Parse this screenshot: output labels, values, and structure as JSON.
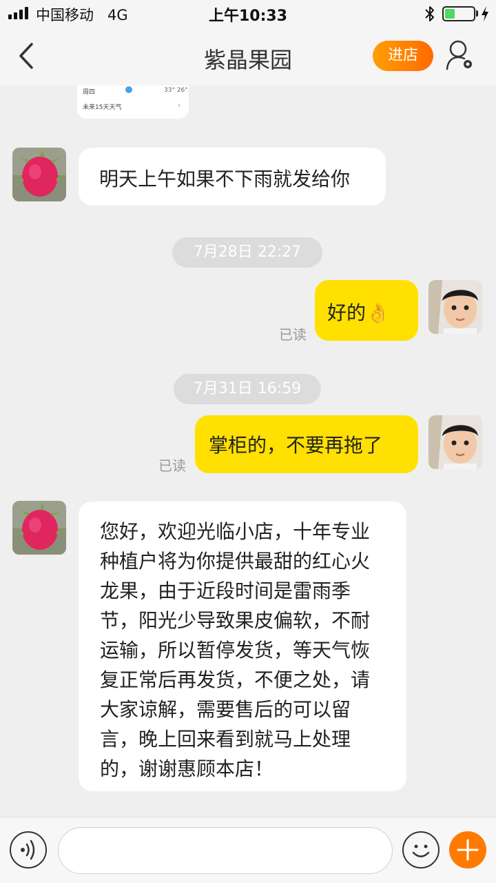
{
  "status_bar": {
    "carrier": "中国移动",
    "network": "4G",
    "time": "上午10:33",
    "battery_level": 0.35
  },
  "nav": {
    "title": "紫晶果园",
    "enter_store": "进店",
    "accent_color": "#ff8a00"
  },
  "weather_card": {
    "day": "周四",
    "temps": "33° 26°",
    "forecast_link": "未来15天天气"
  },
  "messages": [
    {
      "type": "message",
      "sender": "shop",
      "text": "明天上午如果不下雨就发给你"
    },
    {
      "type": "timestamp",
      "text": "7月28日 22:27"
    },
    {
      "type": "message",
      "sender": "me",
      "text": "好的👌",
      "status": "已读"
    },
    {
      "type": "timestamp",
      "text": "7月31日 16:59"
    },
    {
      "type": "message",
      "sender": "me",
      "text": "掌柜的，不要再拖了",
      "status": "已读"
    },
    {
      "type": "message",
      "sender": "shop",
      "text": "您好，欢迎光临小店，十年专业\n种植户将为你提供最甜的红心火\n龙果，由于近段时间是雷雨季\n节，阳光少导致果皮偏软，不耐\n运输，所以暂停发货，等天气恢\n复正常后再发货，不便之处，请\n大家谅解，需要售后的可以留\n言，晚上回来看到就马上处理\n的，谢谢惠顾本店！"
    }
  ],
  "input": {
    "placeholder": "",
    "value": ""
  }
}
